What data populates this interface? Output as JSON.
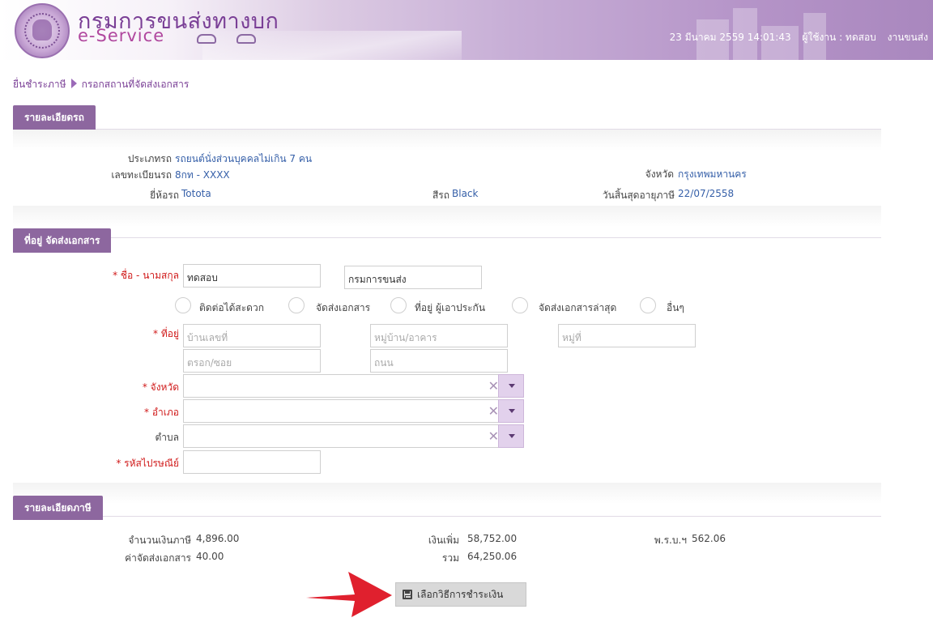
{
  "header": {
    "brand_th": "กรมการขนส่งทางบก",
    "brand_en": "e-Service",
    "datetime": "23 มีนาคม 2559 14:01:43",
    "user": "ผู้ใช้งาน : ทดสอบ",
    "department": "งานขนส่ง"
  },
  "breadcrumb": {
    "step1": "ยื่นชำระภาษี",
    "step2": "กรอกสถานที่จัดส่งเอกสาร"
  },
  "vehicle": {
    "section_title": "รายละเอียดรถ",
    "type_label": "ประเภทรถ",
    "type_value": "รถยนต์นั่งส่วนบุคคลไม่เกิน 7 คน",
    "plate_label": "เลขทะเบียนรถ",
    "plate_value": "8กท - XXXX",
    "province_label": "จังหวัด",
    "province_value": "กรุงเทพมหานคร",
    "brand_label": "ยี่ห้อรถ",
    "brand_value": "Totota",
    "color_label": "สีรถ",
    "color_value": "Black",
    "expiry_label": "วันสิ้นสุดอายุภาษี",
    "expiry_value": "22/07/2558"
  },
  "address": {
    "section_title": "ที่อยู่ จัดส่งเอกสาร",
    "name_label": "ชื่อ - นามสกุล",
    "first_name": "ทดสอบ",
    "last_name": "กรมการขนส่ง",
    "radio_options": [
      "ติดต่อได้สะดวก",
      "จัดส่งเอกสาร",
      "ที่อยู่ ผู้เอาประกัน",
      "จัดส่งเอกสารล่าสุด",
      "อื่นๆ"
    ],
    "addr_label": "ที่อยู่",
    "house_no_ph": "บ้านเลขที่",
    "village_ph": "หมู่บ้าน/อาคาร",
    "moo_ph": "หมู่ที่",
    "soi_ph": "ตรอก/ซอย",
    "road_ph": "ถนน",
    "province_label": "จังหวัด",
    "district_label": "อำเภอ",
    "subdistrict_label": "ตำบล",
    "postcode_label": "รหัสไปรษณีย์",
    "required_mark": "*",
    "clear_glyph": "✕"
  },
  "tax": {
    "section_title": "รายละเอียดภาษี",
    "tax_amount_label": "จำนวนเงินภาษี",
    "tax_amount": "4,896.00",
    "surcharge_label": "เงินเพิ่ม",
    "surcharge": "58,752.00",
    "insurance_label": "พ.ร.บ.ฯ",
    "insurance": "562.06",
    "delivery_label": "ค่าจัดส่งเอกสาร",
    "delivery": "40.00",
    "total_label": "รวม",
    "total": "64,250.06"
  },
  "actions": {
    "pay_method_label": "เลือกวิธีการชำระเงิน"
  },
  "colors": {
    "accent": "#8d679f",
    "link": "#355fa8",
    "required": "#d01a1a",
    "arrow": "#e0202e"
  }
}
